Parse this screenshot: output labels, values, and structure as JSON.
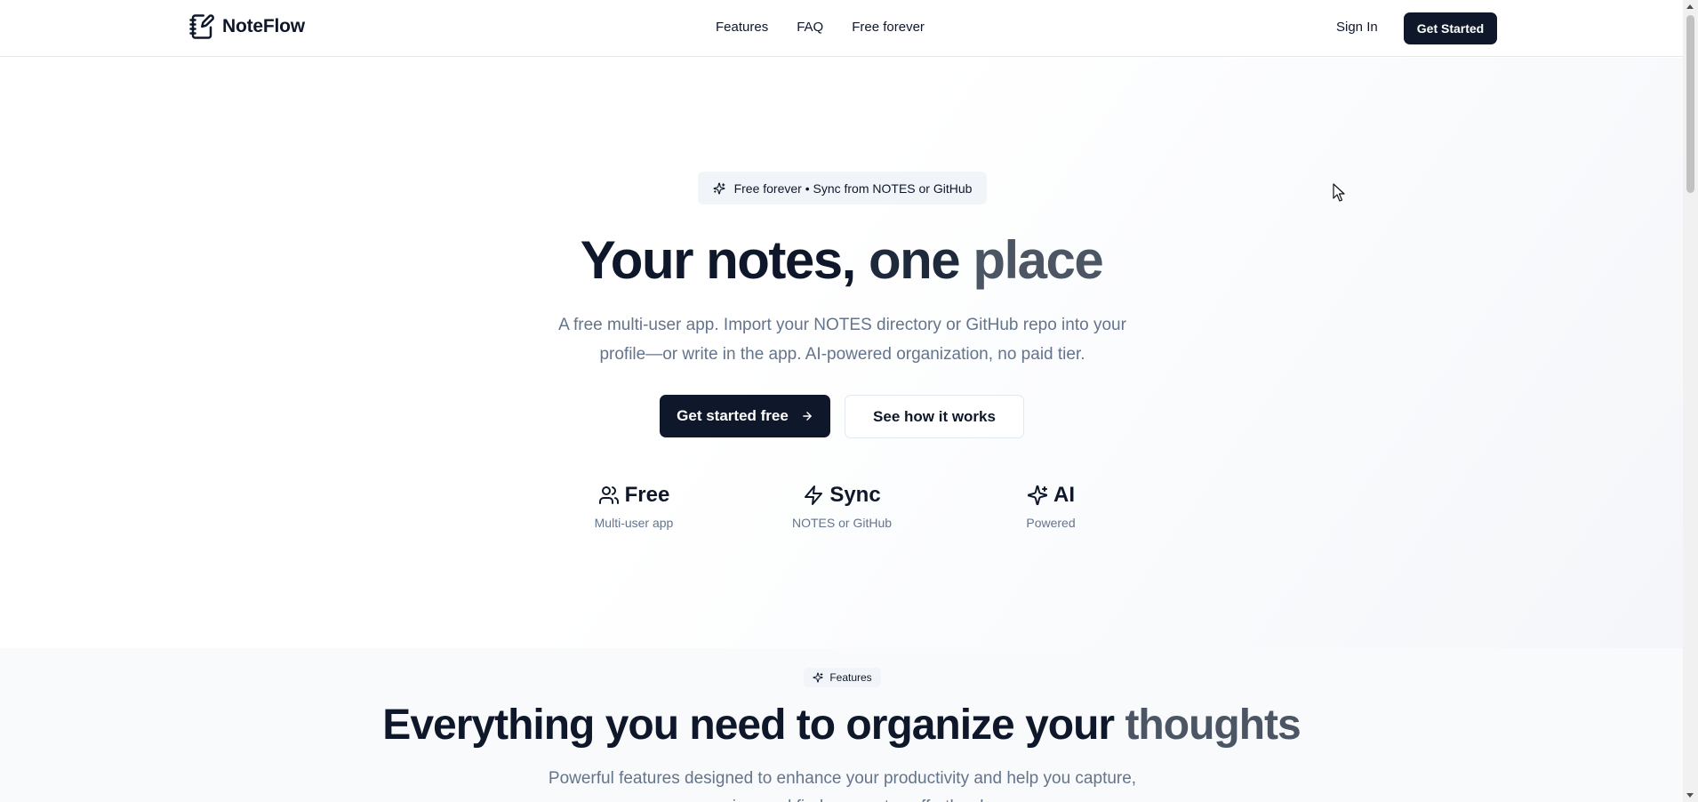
{
  "header": {
    "brand": "NoteFlow",
    "nav": [
      "Features",
      "FAQ",
      "Free forever"
    ],
    "sign_in": "Sign In",
    "get_started": "Get Started"
  },
  "hero": {
    "badge": "Free forever • Sync from NOTES or GitHub",
    "title_part1": "Your notes, ",
    "title_part2": "one ",
    "title_part3": "place",
    "subtitle": "A free multi-user app. Import your NOTES directory or GitHub repo into your profile—or write in the app. AI-powered organization, no paid tier.",
    "primary_button": "Get started free",
    "secondary_button": "See how it works",
    "stats": [
      {
        "icon": "users-icon",
        "title": "Free",
        "subtitle": "Multi-user app"
      },
      {
        "icon": "zap-icon",
        "title": "Sync",
        "subtitle": "NOTES or GitHub"
      },
      {
        "icon": "sparkles-icon",
        "title": "AI",
        "subtitle": "Powered"
      }
    ]
  },
  "features": {
    "badge": "Features",
    "title_part1": "Everything you need to organize your ",
    "title_part2": "thoughts",
    "subtitle": "Powerful features designed to enhance your productivity and help you capture, organize, and find your notes effortlessly."
  },
  "colors": {
    "primary": "#0f172a",
    "muted_text": "#64748b",
    "badge_bg": "#f1f5f9",
    "accent_grey": "#4b5563"
  }
}
